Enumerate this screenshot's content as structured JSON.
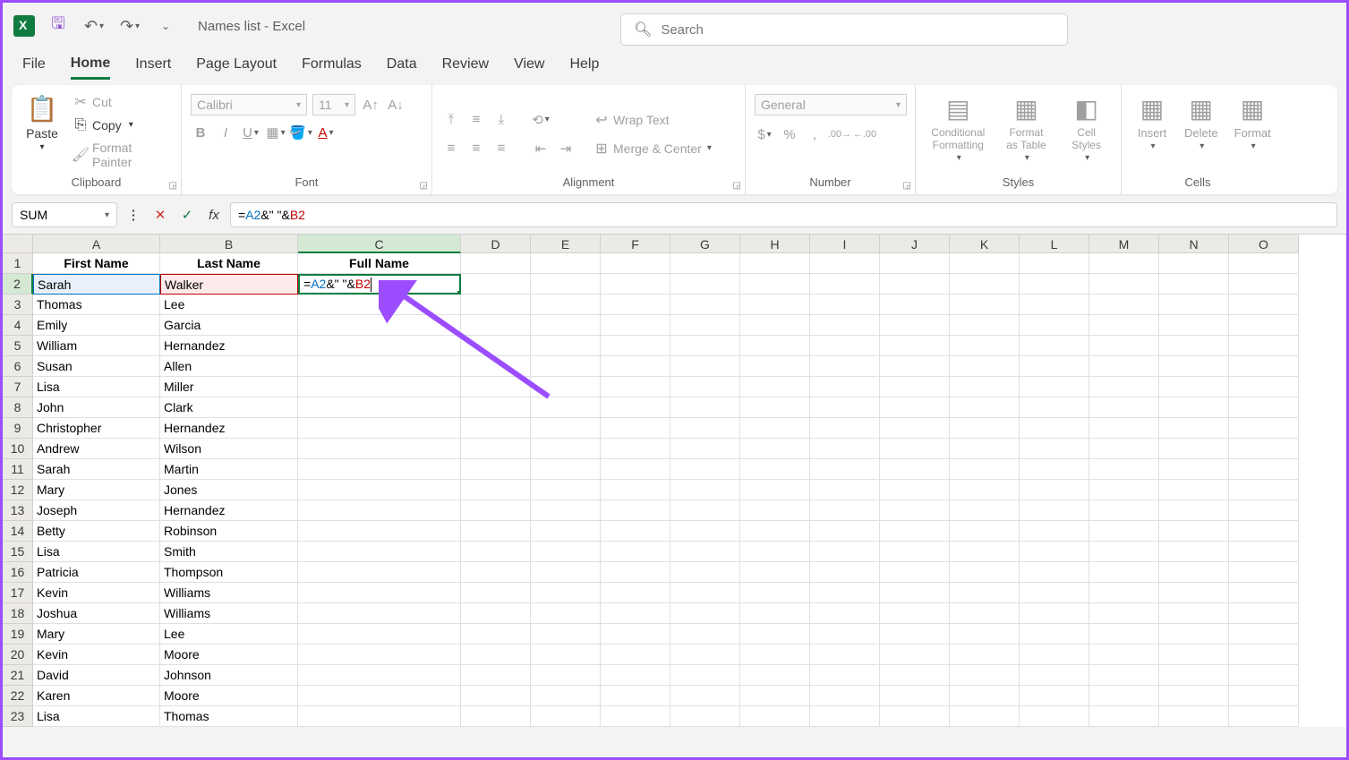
{
  "title": "Names list - Excel",
  "search_placeholder": "Search",
  "tabs": [
    "File",
    "Home",
    "Insert",
    "Page Layout",
    "Formulas",
    "Data",
    "Review",
    "View",
    "Help"
  ],
  "clipboard": {
    "paste": "Paste",
    "cut": "Cut",
    "copy": "Copy",
    "format_painter": "Format Painter",
    "label": "Clipboard"
  },
  "font": {
    "name": "Calibri",
    "size": "11",
    "label": "Font"
  },
  "alignment": {
    "wrap": "Wrap Text",
    "merge": "Merge & Center",
    "label": "Alignment"
  },
  "number": {
    "format": "General",
    "label": "Number"
  },
  "styles": {
    "cond": "Conditional Formatting",
    "table": "Format as Table",
    "cell": "Cell Styles",
    "label": "Styles"
  },
  "cells": {
    "insert": "Insert",
    "delete": "Delete",
    "format": "Format",
    "label": "Cells"
  },
  "namebox": "SUM",
  "formula_parts": {
    "prefix": "=",
    "refA": "A2",
    "amp1": "&\" \"&",
    "refB": "B2"
  },
  "col_letters": [
    "A",
    "B",
    "C",
    "D",
    "E",
    "F",
    "G",
    "H",
    "I",
    "J",
    "K",
    "L",
    "M",
    "N",
    "O"
  ],
  "headers": {
    "a": "First Name",
    "b": "Last Name",
    "c": "Full Name"
  },
  "rows": [
    {
      "n": 1
    },
    {
      "n": 2,
      "a": "Sarah",
      "b": "Walker"
    },
    {
      "n": 3,
      "a": "Thomas",
      "b": "Lee"
    },
    {
      "n": 4,
      "a": "Emily",
      "b": "Garcia"
    },
    {
      "n": 5,
      "a": "William",
      "b": "Hernandez"
    },
    {
      "n": 6,
      "a": "Susan",
      "b": "Allen"
    },
    {
      "n": 7,
      "a": "Lisa",
      "b": "Miller"
    },
    {
      "n": 8,
      "a": "John",
      "b": "Clark"
    },
    {
      "n": 9,
      "a": "Christopher",
      "b": "Hernandez"
    },
    {
      "n": 10,
      "a": "Andrew",
      "b": "Wilson"
    },
    {
      "n": 11,
      "a": "Sarah",
      "b": "Martin"
    },
    {
      "n": 12,
      "a": "Mary",
      "b": "Jones"
    },
    {
      "n": 13,
      "a": "Joseph",
      "b": "Hernandez"
    },
    {
      "n": 14,
      "a": "Betty",
      "b": "Robinson"
    },
    {
      "n": 15,
      "a": "Lisa",
      "b": "Smith"
    },
    {
      "n": 16,
      "a": "Patricia",
      "b": "Thompson"
    },
    {
      "n": 17,
      "a": "Kevin",
      "b": "Williams"
    },
    {
      "n": 18,
      "a": "Joshua",
      "b": "Williams"
    },
    {
      "n": 19,
      "a": "Mary",
      "b": "Lee"
    },
    {
      "n": 20,
      "a": "Kevin",
      "b": "Moore"
    },
    {
      "n": 21,
      "a": "David",
      "b": "Johnson"
    },
    {
      "n": 22,
      "a": "Karen",
      "b": "Moore"
    },
    {
      "n": 23,
      "a": "Lisa",
      "b": "Thomas"
    }
  ]
}
